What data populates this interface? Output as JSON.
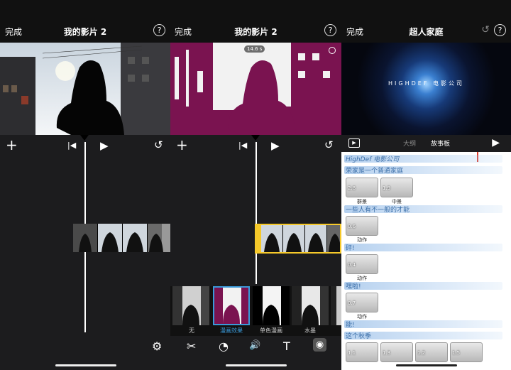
{
  "panel1": {
    "done": "完成",
    "title": "我的影片 2",
    "help": "?"
  },
  "panel2": {
    "done": "完成",
    "title": "我的影片 2",
    "help": "?",
    "badge": "14.6 s",
    "filters": [
      "无",
      "漫画效果",
      "单色漫画",
      "水墨"
    ],
    "selected_filter_index": 1
  },
  "panel3": {
    "done": "完成",
    "title": "超人家庭",
    "help": "?",
    "logo_text": "HIGHDEF 电影公司",
    "tabs": [
      "大纲",
      "故事板"
    ],
    "storyboard": {
      "rows": [
        "HighDef 电影公司",
        "荣家是一个普通家庭",
        "一些人有不一般的才能",
        "砰!",
        "嘿啦!",
        "能!",
        "这个秋季"
      ],
      "tiles": [
        {
          "num": "2.8",
          "caption": "群景"
        },
        {
          "num": "1.9",
          "caption": "中景"
        },
        {
          "num": "0.6",
          "caption": "动作"
        },
        {
          "num": "0.4",
          "caption": "动作"
        },
        {
          "num": "0.7",
          "caption": "动作"
        },
        {
          "num": "1.1",
          "caption": ""
        },
        {
          "num": "1.3",
          "caption": ""
        },
        {
          "num": "1.2",
          "caption": ""
        },
        {
          "num": "1.5",
          "caption": ""
        }
      ]
    }
  },
  "icons": {
    "plus": "+",
    "prev": "|◀",
    "play": "▶",
    "undo": "↺",
    "gear": "⚙",
    "scissors": "✂",
    "speed": "◔",
    "volume": "🔊",
    "text": "T",
    "filter": "◉",
    "help": "?"
  },
  "colors": {
    "accent_yellow": "#f6c92a",
    "filter_magenta": "#7a1350",
    "selected_filter_label": "#3a9ad9"
  }
}
